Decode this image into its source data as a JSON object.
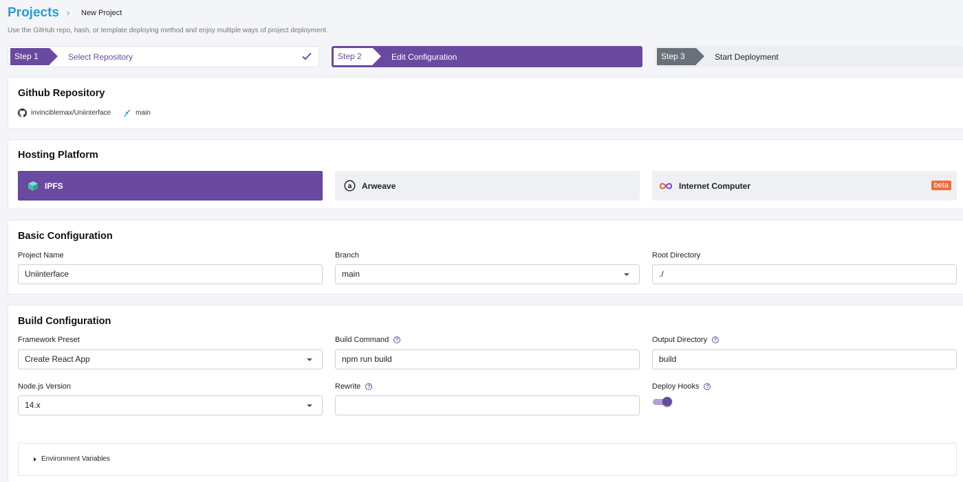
{
  "header": {
    "title": "Projects",
    "breadcrumb_sep": "›",
    "breadcrumb_current": "New Project",
    "subtitle": "Use the GitHub repo, hash, or template deploying method and enjoy multiple ways of project deployment."
  },
  "steps": [
    {
      "tag": "Step 1",
      "label": "Select Repository",
      "state": "done"
    },
    {
      "tag": "Step 2",
      "label": "Edit Configuration",
      "state": "active"
    },
    {
      "tag": "Step 3",
      "label": "Start Deployment",
      "state": "pending"
    }
  ],
  "repository": {
    "title": "Github Repository",
    "repo": "invinciblemax/Uniinterface",
    "branch": "main",
    "icons": [
      "github-icon",
      "branch-icon"
    ]
  },
  "hosting": {
    "title": "Hosting Platform",
    "platforms": [
      {
        "name": "IPFS",
        "icon": "ipfs-cube-icon",
        "selected": true
      },
      {
        "name": "Arweave",
        "icon": "arweave-icon",
        "selected": false
      },
      {
        "name": "Internet Computer",
        "icon": "infinity-icon",
        "selected": false,
        "badge": "beta"
      }
    ]
  },
  "basic": {
    "title": "Basic Configuration",
    "project_name_label": "Project Name",
    "project_name_value": "Uniinterface",
    "branch_label": "Branch",
    "branch_value": "main",
    "root_label": "Root Directory",
    "root_value": "./"
  },
  "build": {
    "title": "Build Configuration",
    "framework_label": "Framework Preset",
    "framework_value": "Create React App",
    "command_label": "Build Command",
    "command_value": "npm run build",
    "output_label": "Output Directory",
    "output_value": "build",
    "node_label": "Node.js Version",
    "node_value": "14.x",
    "rewrite_label": "Rewrite",
    "rewrite_value": "",
    "hooks_label": "Deploy Hooks",
    "hooks_enabled": true,
    "help_glyph": "?",
    "env_label": "Environment Variables"
  },
  "colors": {
    "accent": "#6a4aa0",
    "title_blue": "#2a9bd8",
    "beta": "#f26b38"
  }
}
